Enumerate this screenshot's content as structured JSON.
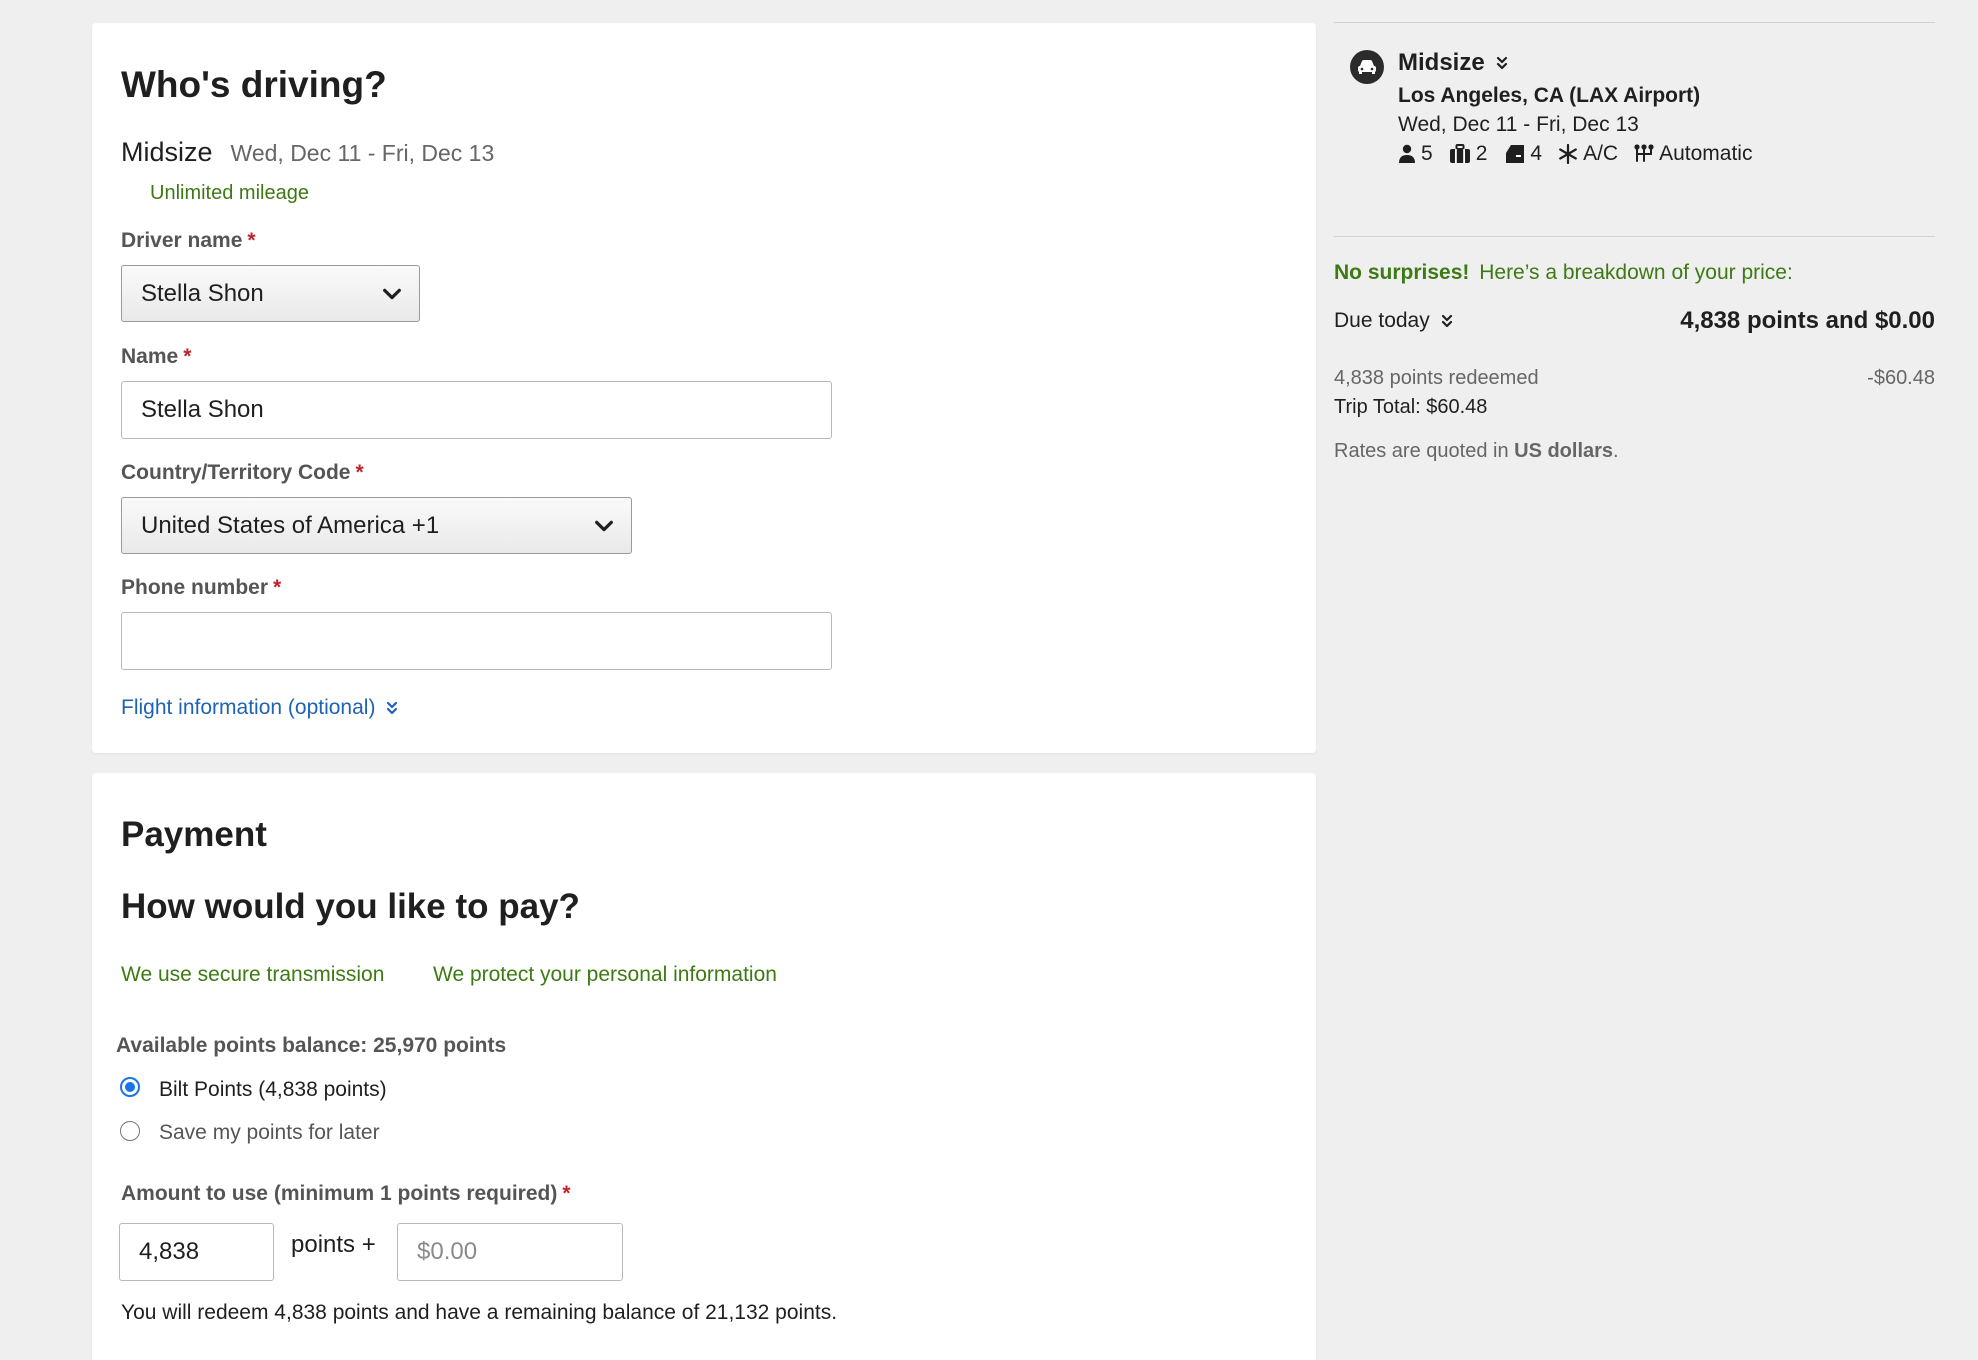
{
  "driver": {
    "heading": "Who's driving?",
    "car_class": "Midsize",
    "dates": "Wed, Dec 11 - Fri, Dec 13",
    "mileage": "Unlimited mileage",
    "driver_name_label": "Driver name",
    "driver_name_value": "Stella Shon",
    "name_label": "Name",
    "name_value": "Stella Shon",
    "country_label": "Country/Territory Code",
    "country_value": "United States of America +1",
    "phone_label": "Phone number",
    "phone_value": "",
    "flight_link": "Flight information (optional)",
    "required_mark": "*"
  },
  "payment": {
    "heading": "Payment",
    "subheading": "How would you like to pay?",
    "secure_text": "We use secure transmission",
    "protect_text": "We protect your personal information",
    "balance_text": "Available points balance: 25,970 points",
    "option_points": "Bilt Points (4,838 points)",
    "option_save": "Save my points for later",
    "amount_label": "Amount to use (minimum 1 points required)",
    "points_value": "4,838",
    "points_plus": "points +",
    "cash_placeholder": "$0.00",
    "redeem_note": "You will redeem 4,838 points and have a remaining balance of 21,132 points."
  },
  "summary": {
    "car_class": "Midsize",
    "location": "Los Angeles, CA (LAX Airport)",
    "dates": "Wed, Dec 11 - Fri, Dec 13",
    "specs": {
      "passengers": "5",
      "bags": "2",
      "doors": "4",
      "ac": "A/C",
      "transmission": "Automatic"
    },
    "no_surprises": "No surprises!",
    "breakdown": "Here’s a breakdown of your price:",
    "due_today_label": "Due today",
    "due_today_value": "4,838 points and $0.00",
    "points_redeemed_label": "4,838 points redeemed",
    "points_redeemed_value": "-$60.48",
    "trip_total": "Trip Total: $60.48",
    "rates_prefix": "Rates are quoted in ",
    "rates_currency": "US dollars",
    "rates_suffix": "."
  },
  "colors": {
    "background": "#efefef",
    "green": "#3d7a14",
    "link": "#1f63b5",
    "required": "#c0242b",
    "radio_selected": "#1a73e8"
  }
}
